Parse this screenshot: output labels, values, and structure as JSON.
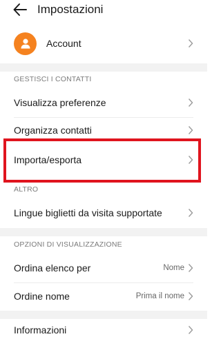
{
  "header": {
    "title": "Impostazioni"
  },
  "account": {
    "label": "Account"
  },
  "sections": {
    "contacts": "GESTISCI I CONTATTI",
    "other": "ALTRO",
    "display": "OPZIONI DI VISUALIZZAZIONE"
  },
  "rows": {
    "view_prefs": "Visualizza preferenze",
    "organize": "Organizza contatti",
    "import_export": "Importa/esporta",
    "languages": "Lingue biglietti da visita supportate",
    "sort_list": {
      "label": "Ordina elenco per",
      "value": "Nome"
    },
    "name_order": {
      "label": "Ordine nome",
      "value": "Prima il nome"
    },
    "info": "Informazioni"
  },
  "colors": {
    "accent": "#f5821f",
    "highlight": "#e0141e"
  }
}
